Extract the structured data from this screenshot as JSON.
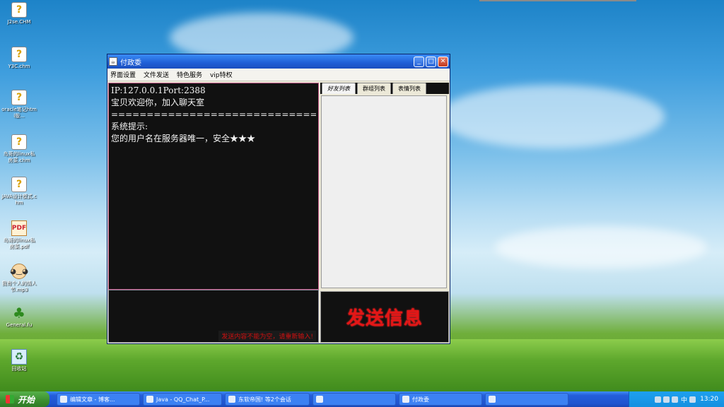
{
  "desktop": {
    "icons": [
      {
        "label": "J2se.CHM",
        "icon": "chm-icon"
      },
      {
        "label": "Y3C.chm",
        "icon": "chm-icon"
      },
      {
        "label": "oracle笔记html版...",
        "icon": "chm-icon"
      },
      {
        "label": "鸟哥的linux私房菜.chm",
        "icon": "chm-icon"
      },
      {
        "label": "JAVA设计模式.chm",
        "icon": "chm-icon"
      },
      {
        "label": "鸟哥的linux私房菜.pdf",
        "icon": "pdf-icon"
      },
      {
        "label": "我有个人的情人节.mp3",
        "icon": "face-icon"
      },
      {
        "label": "General.fu",
        "icon": "tree-icon"
      },
      {
        "label": "回收站",
        "icon": "recycle-bin-icon"
      }
    ]
  },
  "window": {
    "title": "付政委",
    "controls": {
      "minimize": "_",
      "maximize": "□",
      "close": "✕"
    },
    "menu": [
      "界面设置",
      "文件发送",
      "特色服务",
      "vip特权"
    ],
    "chat_lines": [
      "IP:127.0.0.1Port:2388",
      "宝贝欢迎你，加入聊天室",
      "====================================",
      "系统提示:",
      "您的用户名在服务器唯一，安全★★★"
    ],
    "warning": "发送内容不能为空，请重新输入!",
    "tabs": [
      "好友列表",
      "群组列表",
      "表情列表"
    ],
    "active_tab": "好友列表",
    "send_button": "发送信息"
  },
  "taskbar": {
    "start_label": "开始",
    "buttons": [
      "编辑文章 - 博客...",
      "Java - QQ_Chat_P...",
      "东软帝国! 等2个会话",
      "",
      "付政委",
      ""
    ],
    "ime": "中",
    "clock": "13:20"
  }
}
